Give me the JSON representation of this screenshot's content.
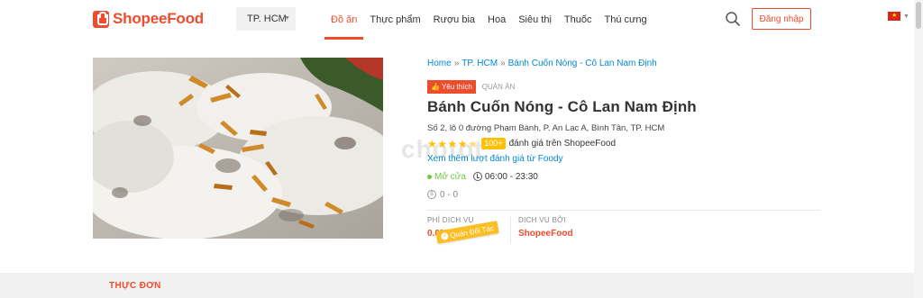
{
  "header": {
    "logo_text": "ShopeeFood",
    "city": "TP. HCM",
    "nav": [
      {
        "label": "Đồ ăn",
        "active": true
      },
      {
        "label": "Thực phẩm",
        "active": false
      },
      {
        "label": "Rượu bia",
        "active": false
      },
      {
        "label": "Hoa",
        "active": false
      },
      {
        "label": "Siêu thị",
        "active": false
      },
      {
        "label": "Thuốc",
        "active": false
      },
      {
        "label": "Thú cưng",
        "active": false
      }
    ],
    "search_icon": "search-icon",
    "login_label": "Đăng nhập",
    "language_icon": "vietnam-flag-icon"
  },
  "breadcrumb": {
    "home": "Home",
    "sep": "»",
    "city": "TP. HCM",
    "current": "Bánh Cuốn Nóng - Cô Lan Nam Định"
  },
  "restaurant": {
    "favorite_tag": "Yêu thích",
    "kind": "QUÁN ĂN",
    "name": "Bánh Cuốn Nóng - Cô Lan Nam Định",
    "address": "Số 2, lô 0 đường Phạm Bành, P. An Lạc A, Bình Tân, TP. HCM",
    "rating": 4.5,
    "rating_count": "100+",
    "rating_text": "đánh giá trên ShopeeFood",
    "foody_link": "Xem thêm lượt đánh giá từ Foody",
    "status": "Mở cửa",
    "hours": "06:00 - 23:30",
    "price_range": "0 - 0"
  },
  "service": {
    "fee_label": "PHÍ DỊCH VỤ",
    "fee_value": "0.0%",
    "by_label": "DỊCH VỤ BỞI",
    "by_value": "ShopeeFood",
    "badge": "Quán Đối Tác"
  },
  "colors": {
    "brand": "#ee4d2d",
    "link": "#0288d1",
    "open": "#6cc942",
    "star": "#ffc107"
  },
  "menu": {
    "title": "THỰC ĐƠN"
  }
}
